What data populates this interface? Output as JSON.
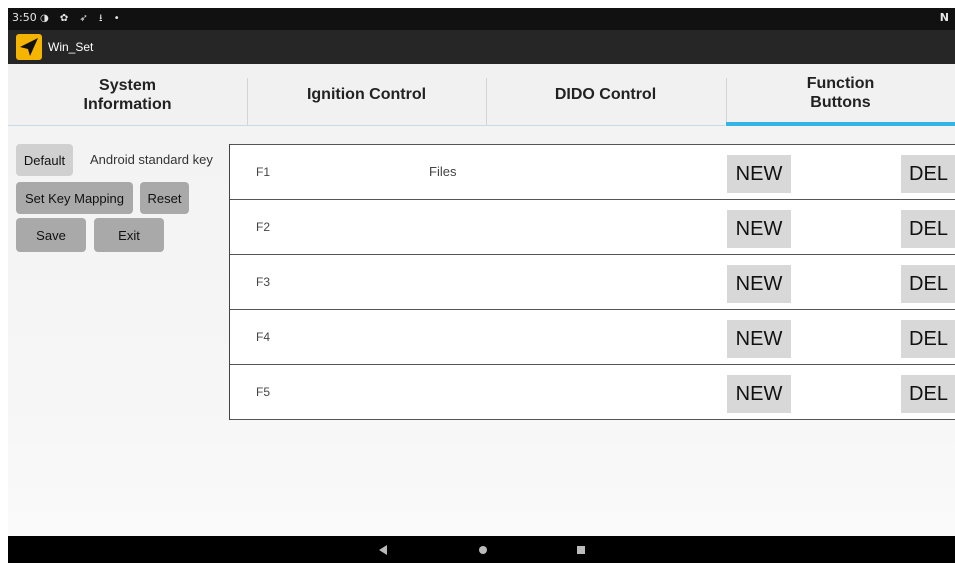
{
  "status_bar": {
    "time": "3:50",
    "icons": [
      "notification-icon",
      "settings-icon",
      "location-icon",
      "download-icon",
      "dot-icon"
    ],
    "icon_glyphs": "◑ ✿ ➶ ⭳ •",
    "nfc": "N"
  },
  "titlebar": {
    "app_title": "Win_Set",
    "icon_color": "#f5b400"
  },
  "tabs": [
    {
      "label": "System\nInformation",
      "active": false
    },
    {
      "label": "Ignition Control",
      "active": false
    },
    {
      "label": "DIDO Control",
      "active": false
    },
    {
      "label": "Function\nButtons",
      "active": true
    }
  ],
  "accent_color": "#33b5e5",
  "controls": {
    "default_label": "Default",
    "mode_text": "Android standard key",
    "set_key_mapping_label": "Set Key Mapping",
    "reset_label": "Reset",
    "save_label": "Save",
    "exit_label": "Exit"
  },
  "function_rows": [
    {
      "key": "F1",
      "name": "Files",
      "new_label": "NEW",
      "del_label": "DEL"
    },
    {
      "key": "F2",
      "name": "",
      "new_label": "NEW",
      "del_label": "DEL"
    },
    {
      "key": "F3",
      "name": "",
      "new_label": "NEW",
      "del_label": "DEL"
    },
    {
      "key": "F4",
      "name": "",
      "new_label": "NEW",
      "del_label": "DEL"
    },
    {
      "key": "F5",
      "name": "",
      "new_label": "NEW",
      "del_label": "DEL"
    }
  ],
  "nav_bar": [
    "back-icon",
    "home-icon",
    "recents-icon"
  ]
}
